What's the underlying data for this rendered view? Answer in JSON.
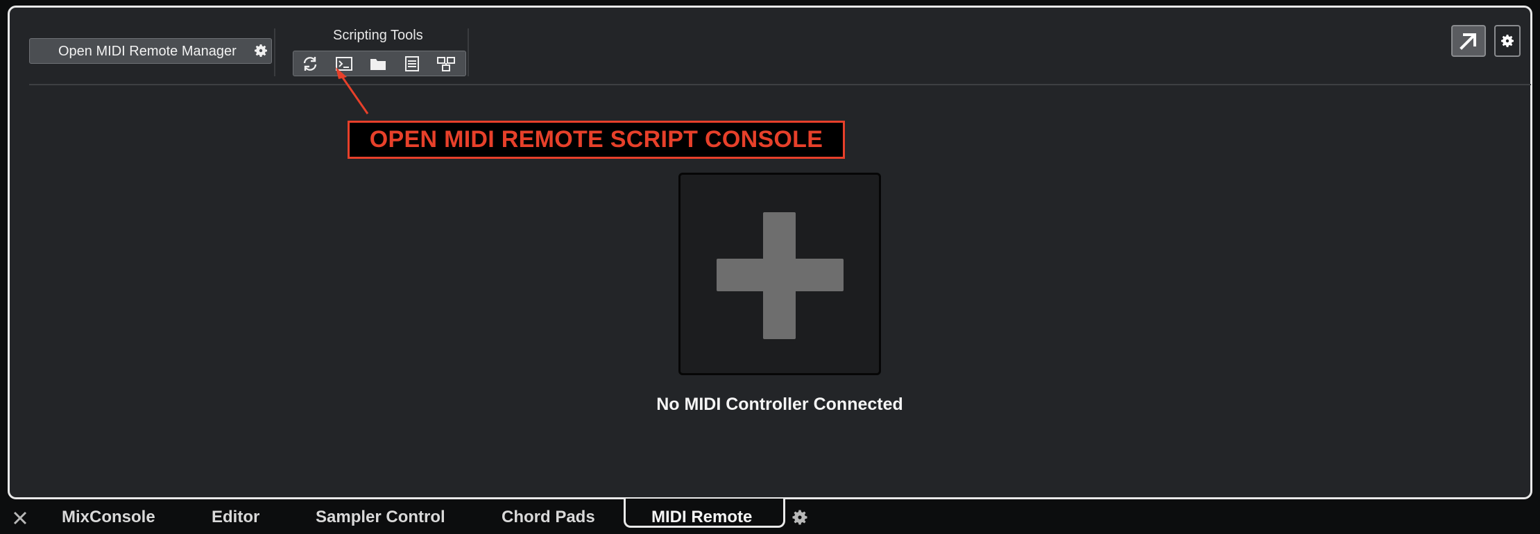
{
  "toolbar": {
    "manager_button_label": "Open MIDI Remote Manager",
    "scripting_tools_title": "Scripting Tools",
    "tools": [
      {
        "name": "reload-scripts",
        "icon": "refresh-icon"
      },
      {
        "name": "open-script-console",
        "icon": "terminal-icon"
      },
      {
        "name": "open-scripts-folder",
        "icon": "folder-icon"
      },
      {
        "name": "open-documentation",
        "icon": "document-icon"
      },
      {
        "name": "open-surface-editor",
        "icon": "layout-icon"
      }
    ]
  },
  "annotation": {
    "text": "OPEN MIDI REMOTE SCRIPT CONSOLE",
    "color": "#e7402a"
  },
  "main": {
    "add_tile_icon": "plus-icon",
    "status_text": "No MIDI Controller Connected"
  },
  "tabs": [
    {
      "label": "MixConsole",
      "active": false
    },
    {
      "label": "Editor",
      "active": false
    },
    {
      "label": "Sampler Control",
      "active": false
    },
    {
      "label": "Chord Pads",
      "active": false
    },
    {
      "label": "MIDI Remote",
      "active": true
    }
  ],
  "colors": {
    "panel_bg": "#232528",
    "accent": "#e7402a",
    "button_bg": "#4b4e52"
  }
}
